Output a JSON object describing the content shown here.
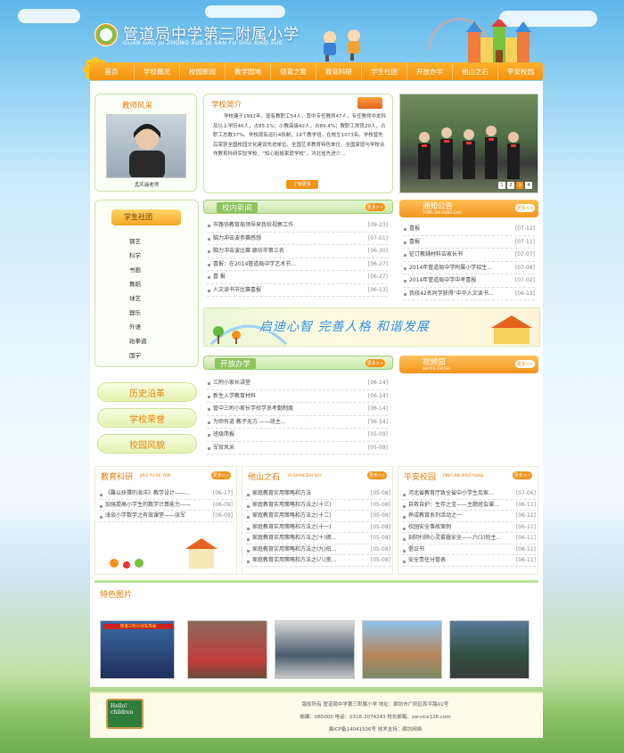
{
  "header": {
    "site_title": "管道局中学第三附属小学",
    "site_subtitle": "GUAN DAO JU ZHONG XUE DI SAN FU SHU XIAO XUE"
  },
  "nav": [
    "首页",
    "学校概况",
    "校园新闻",
    "教学园地",
    "德育之窗",
    "教育科研",
    "学生社团",
    "开放办学",
    "他山之石",
    "平安校园"
  ],
  "teacher": {
    "title": "教师风采",
    "caption": "孟庆遥老师"
  },
  "intro": {
    "title": "学校简介",
    "text": "学校建于1992年，现有教职工54人，其中专任教师47人，专任教师中本科及以上学历40人，占85.1%；小教高级42人，占89.4%；教职工党员20人，占职工总数37%。学校现有运行4轨制，19个教学班，在校生1073名。学校曾先后荣获全国校园文化建设先进单位、全国艺术教育特色单位、全国家庭与学校合作教育科研实验学校、“知心姐姐家庭学校”，河北省先进少...",
    "more": "了解更多"
  },
  "slider_dots": [
    "1",
    "2",
    "3",
    "4"
  ],
  "club": {
    "title": "学生社团",
    "items": [
      "钢艺",
      "科学",
      "书画",
      "舞蹈",
      "球艺",
      "器乐",
      "外语",
      "跆拳道",
      "国学"
    ]
  },
  "pills": [
    "历史沿革",
    "学校荣誉",
    "校园风貌"
  ],
  "news": {
    "title": "校内新闻",
    "more": "更多>>",
    "items": [
      {
        "t": "市路协教育局领导来我校视察工作",
        "d": "[09-23]"
      },
      {
        "t": "脑力冲击波参赛感想",
        "d": "[07-01]"
      },
      {
        "t": "脑力冲击波比赛 廊坊市第三名",
        "d": "[06-30]"
      },
      {
        "t": "喜报：在2014管道局中学艺术节...",
        "d": "[06-27]"
      },
      {
        "t": "喜 报",
        "d": "[06-27]"
      },
      {
        "t": "人文读书节比赛喜报",
        "d": "[06-13]"
      }
    ]
  },
  "notice": {
    "title": "通知公告",
    "sub": "TONG ZHI GONG GAO",
    "more": "更多>>",
    "items": [
      {
        "t": "喜报",
        "d": "[07-12]"
      },
      {
        "t": "喜报",
        "d": "[07-11]"
      },
      {
        "t": "征订教辅材料告家长书",
        "d": "[07-07]"
      },
      {
        "t": "2014年管道局中学附属小学招生...",
        "d": "[07-08]"
      },
      {
        "t": "2014年管道局中学中考喜报",
        "d": "[07-02]"
      },
      {
        "t": "我校42名同学获得“中华人文读书...",
        "d": "[06-13]"
      }
    ]
  },
  "banner": {
    "text": "启迪心智  完善人格  和谐发展"
  },
  "open": {
    "title": "开放办学",
    "more": "更多>>",
    "items": [
      {
        "t": "三附小家长讲堂",
        "d": "[06-14]"
      },
      {
        "t": "新生入学教育材料",
        "d": "[06-14]"
      },
      {
        "t": "管中三附小家长学校学员考勤制度",
        "d": "[06-14]"
      },
      {
        "t": "为师有道 教子无方 ——班主...",
        "d": "[06-14]"
      },
      {
        "t": "班级简报",
        "d": "[05-09]"
      },
      {
        "t": "军官风采",
        "d": "[05-09]"
      }
    ]
  },
  "video": {
    "title": "视频园",
    "sub": "SHI PIN ZHI SHI",
    "more": "更多>>"
  },
  "research": {
    "title": "教育科研",
    "sub": "JIAO YU KE YAN",
    "more": "更多>>",
    "items": [
      {
        "t": "《難以抉擇的海洋》教学设计——...",
        "d": "[06-17]"
      },
      {
        "t": "加强提高小学生的数学计算能力——",
        "d": "[06-09]"
      },
      {
        "t": "浅谈小学数学之有效课堂——张军",
        "d": "[06-09]"
      }
    ]
  },
  "other": {
    "title": "他山之石",
    "sub": "TA SHAN ZHI SHI",
    "more": "更多>>",
    "items": [
      {
        "t": "家庭教育实用策略和方法",
        "d": "[05-08]"
      },
      {
        "t": "家庭教育实用策略和方法之(十三)",
        "d": "[05-08]"
      },
      {
        "t": "家庭教育实用策略和方法之(十二)",
        "d": "[05-08]"
      },
      {
        "t": "家庭教育实用策略和方法之(十一)",
        "d": "[05-08]"
      },
      {
        "t": "家庭教育实用策略和方法之(十)德...",
        "d": "[05-08]"
      },
      {
        "t": "家庭教育实用策略和方法之(九)伯...",
        "d": "[05-08]"
      },
      {
        "t": "家庭教育实用策略和方法之(八)宽...",
        "d": "[05-08]"
      }
    ]
  },
  "safety": {
    "title": "平安校园",
    "sub": "PING AN XIAO YUAN",
    "more": "更多>>",
    "items": [
      {
        "t": "河北省教育厅致全省中小学生及家...",
        "d": "[07-06]"
      },
      {
        "t": "自救自护：生存之宝——主题班会课...",
        "d": "[06-11]"
      },
      {
        "t": "养成教育系列活动之一",
        "d": "[06-11]"
      },
      {
        "t": "校园安全事故案例",
        "d": "[06-11]"
      },
      {
        "t": "刻阴扫除心灵雾霾安全——六(1)班主...",
        "d": "[06-11]"
      },
      {
        "t": "倡议书",
        "d": "[06-11]"
      },
      {
        "t": "安全责任分管表",
        "d": "[06-11]"
      }
    ]
  },
  "featured": {
    "title": "特色图片",
    "photo_caption": "管道三附小冠军风采",
    "photos": [
      "photo-1",
      "photo-2",
      "photo-3",
      "photo-4",
      "photo-5",
      "photo-6"
    ]
  },
  "footer": {
    "line1": "版权所有 管道局中学第三附属小学 地址：廊坊市广阳区和平路01号",
    "line2": "邮编：065000  电话：0316-2074243  校长邮箱：zarvice126.com",
    "line3": "冀ICP备14041506号  技术支持：廊坊网络",
    "badge": "Hello! children"
  },
  "colors": {
    "orange": "#f39418",
    "green": "#7cc242",
    "sky": "#5eb7ea"
  }
}
